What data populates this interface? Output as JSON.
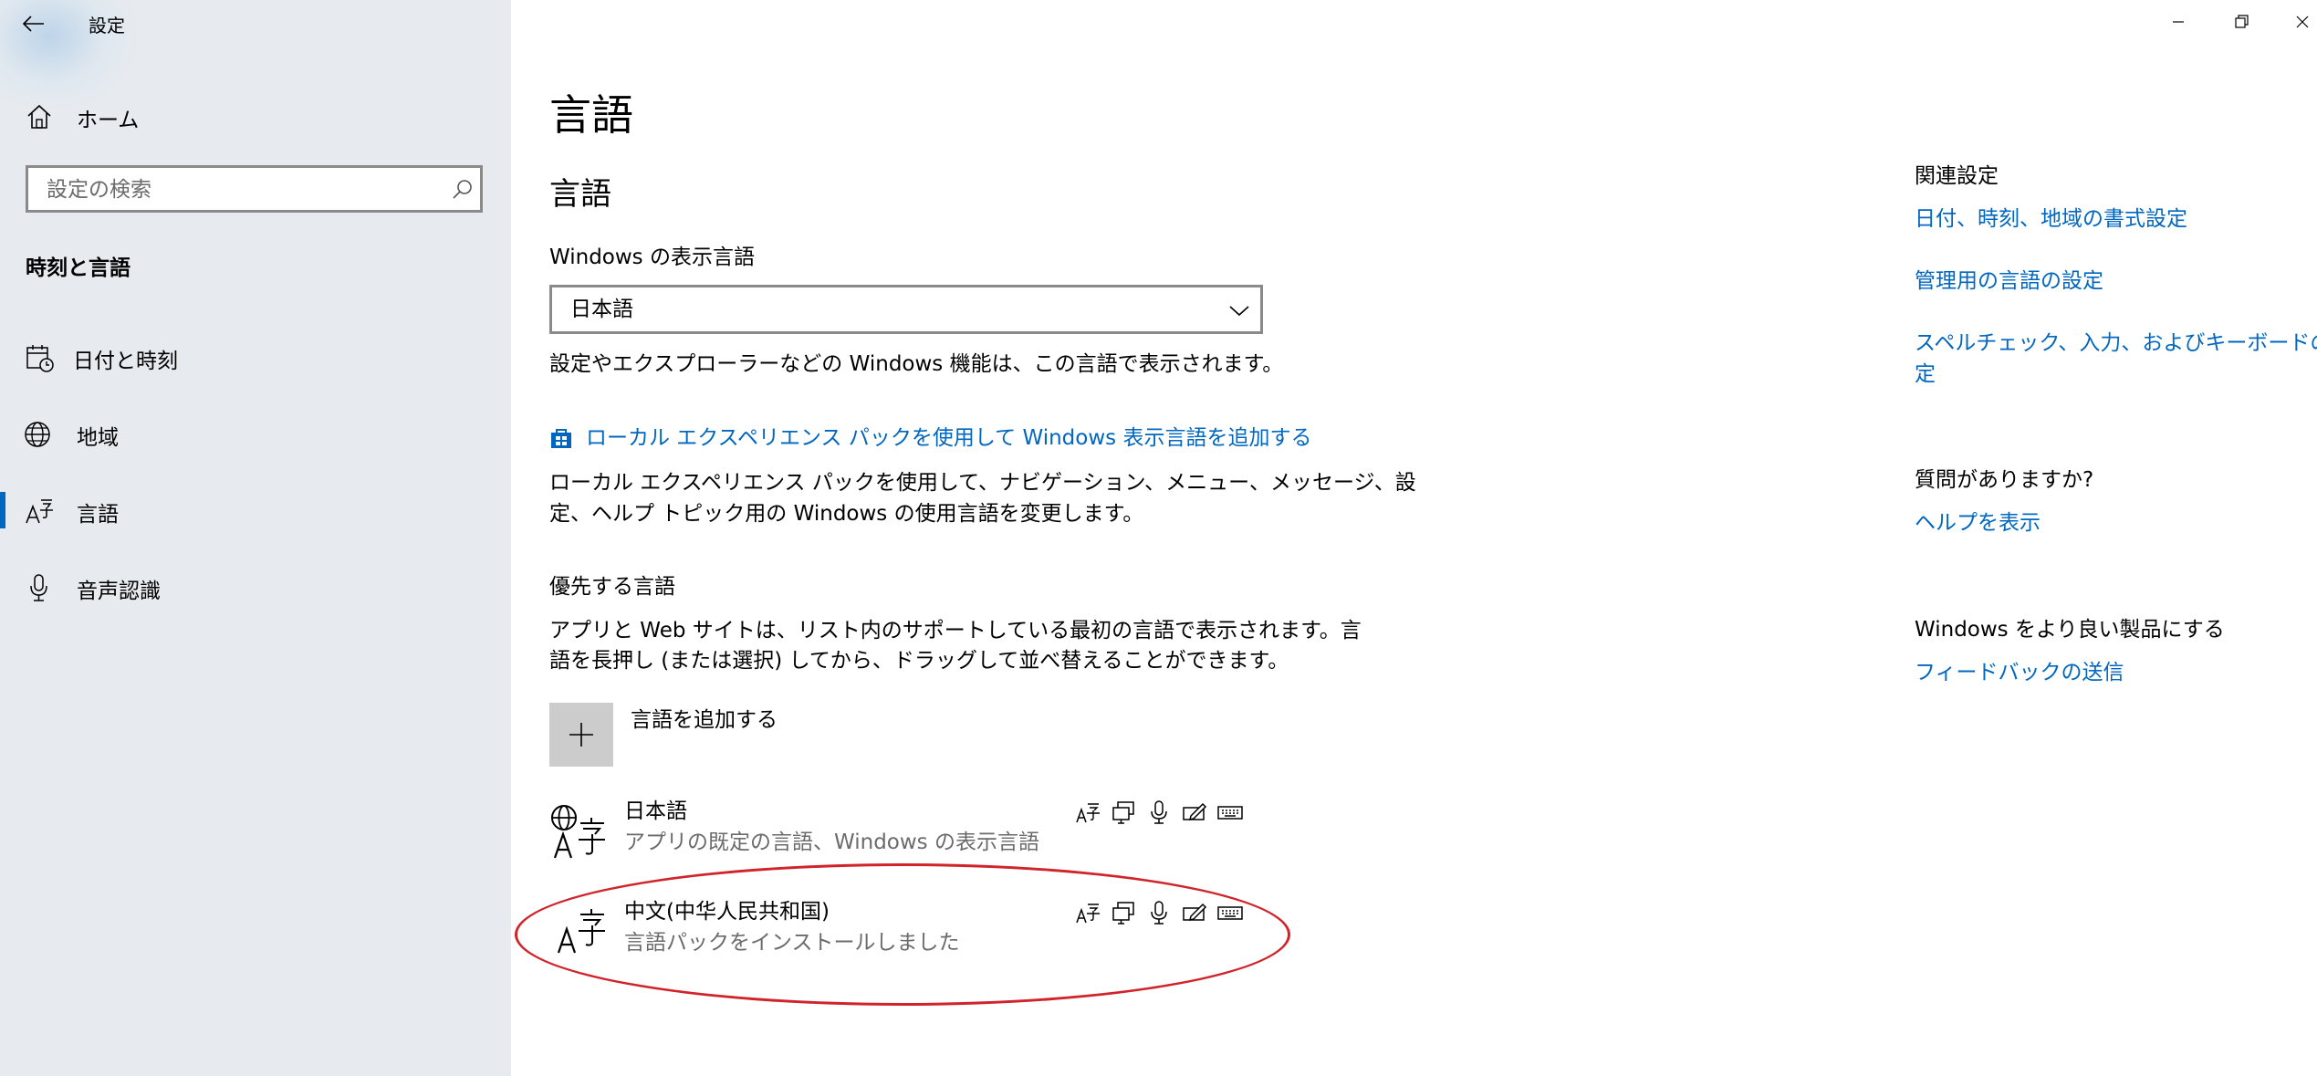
{
  "window": {
    "title": "設定"
  },
  "sidebar": {
    "home_label": "ホーム",
    "search_placeholder": "設定の検索",
    "section_title": "時刻と言語",
    "items": [
      {
        "label": "日付と時刻",
        "icon": "calendar-clock-icon"
      },
      {
        "label": "地域",
        "icon": "globe-icon"
      },
      {
        "label": "言語",
        "icon": "language-icon",
        "selected": true
      },
      {
        "label": "音声認識",
        "icon": "microphone-icon"
      }
    ]
  },
  "main": {
    "page_title": "言語",
    "section_title": "言語",
    "display_language": {
      "label": "Windows の表示言語",
      "selected": "日本語",
      "description": "設定やエクスプローラーなどの Windows 機能は、この言語で表示されます。"
    },
    "local_experience_link": "ローカル エクスペリエンス パックを使用して Windows 表示言語を追加する",
    "local_experience_desc_line1": "ローカル エクスペリエンス パックを使用して、ナビゲーション、メニュー、メッセージ、設",
    "local_experience_desc_line2": "定、ヘルプ トピック用の Windows の使用言語を変更します。",
    "preferred": {
      "title": "優先する言語",
      "desc_line1": "アプリと Web サイトは、リスト内のサポートしている最初の言語で表示されます。言",
      "desc_line2": "語を長押し (または選択) してから、ドラッグして並べ替えることができます。",
      "add_label": "言語を追加する",
      "languages": [
        {
          "name": "日本語",
          "subtitle": "アプリの既定の言語、Windows の表示言語"
        },
        {
          "name": "中文(中华人民共和国)",
          "subtitle": "言語パックをインストールしました"
        }
      ]
    }
  },
  "related": {
    "title": "関連設定",
    "links": [
      "日付、時刻、地域の書式設定",
      "管理用の言語の設定",
      "スペルチェック、入力、およびキーボードの設",
      "定"
    ]
  },
  "help": {
    "title": "質問がありますか?",
    "link": "ヘルプを表示"
  },
  "feedback": {
    "title": "Windows をより良い製品にする",
    "link": "フィードバックの送信"
  },
  "colors": {
    "accent": "#0067c0",
    "sidebar_bg": "#e7ebef",
    "highlight": "#d0232a"
  }
}
